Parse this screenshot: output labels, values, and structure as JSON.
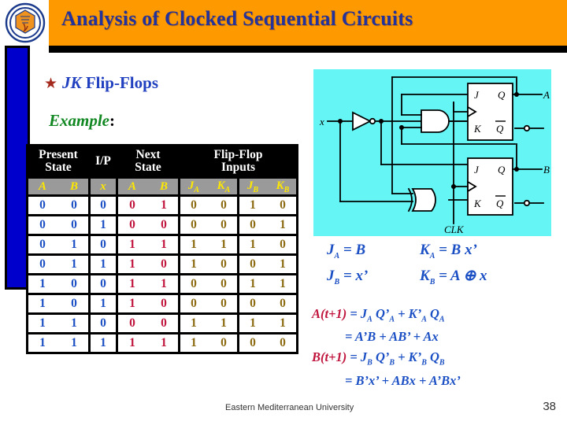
{
  "slide": {
    "title": "Analysis of Clocked Sequential Circuits",
    "logo_icon": "university-seal-icon",
    "bullet": {
      "star_icon": "star-bullet-icon",
      "italic_part": "JK",
      "upright_part": "Flip-Flops"
    },
    "example_label": "Example",
    "example_colon": ":",
    "colors": {
      "title_bar": "#FF9900",
      "title_text": "#23339B",
      "side_bar": "#0000CC",
      "circuit_bg": "#66F5F5",
      "present_state": "#1B4FC4",
      "next_state": "#C0143C",
      "ff_inputs": "#8C6A10",
      "subheader_bg": "#9A9A9A",
      "subheader_text": "#FFE800",
      "example_text": "#118822",
      "star": "#A52A1E"
    }
  },
  "table": {
    "group_headers": [
      {
        "label": "Present\nState",
        "colspan": 2
      },
      {
        "label": "I/P",
        "colspan": 1
      },
      {
        "label": "Next\nState",
        "colspan": 2
      },
      {
        "label": "Flip-Flop\nInputs",
        "colspan": 4
      }
    ],
    "group_headers_flat": [
      "Present State",
      "I/P",
      "Next State",
      "Flip-Flop Inputs"
    ],
    "sub_headers": [
      {
        "text": "A",
        "sub": ""
      },
      {
        "text": "B",
        "sub": ""
      },
      {
        "text": "x",
        "sub": ""
      },
      {
        "text": "A",
        "sub": ""
      },
      {
        "text": "B",
        "sub": ""
      },
      {
        "text": "J",
        "sub": "A"
      },
      {
        "text": "K",
        "sub": "A"
      },
      {
        "text": "J",
        "sub": "B"
      },
      {
        "text": "K",
        "sub": "B"
      }
    ],
    "rows": [
      {
        "present": [
          "0",
          "0"
        ],
        "input": [
          "0"
        ],
        "next": [
          "0",
          "1"
        ],
        "ff": [
          "0",
          "0",
          "1",
          "0"
        ]
      },
      {
        "present": [
          "0",
          "0"
        ],
        "input": [
          "1"
        ],
        "next": [
          "0",
          "0"
        ],
        "ff": [
          "0",
          "0",
          "0",
          "1"
        ]
      },
      {
        "present": [
          "0",
          "1"
        ],
        "input": [
          "0"
        ],
        "next": [
          "1",
          "1"
        ],
        "ff": [
          "1",
          "1",
          "1",
          "0"
        ]
      },
      {
        "present": [
          "0",
          "1"
        ],
        "input": [
          "1"
        ],
        "next": [
          "1",
          "0"
        ],
        "ff": [
          "1",
          "0",
          "0",
          "1"
        ]
      },
      {
        "present": [
          "1",
          "0"
        ],
        "input": [
          "0"
        ],
        "next": [
          "1",
          "1"
        ],
        "ff": [
          "0",
          "0",
          "1",
          "1"
        ]
      },
      {
        "present": [
          "1",
          "0"
        ],
        "input": [
          "1"
        ],
        "next": [
          "1",
          "0"
        ],
        "ff": [
          "0",
          "0",
          "0",
          "0"
        ]
      },
      {
        "present": [
          "1",
          "1"
        ],
        "input": [
          "0"
        ],
        "next": [
          "0",
          "0"
        ],
        "ff": [
          "1",
          "1",
          "1",
          "1"
        ]
      },
      {
        "present": [
          "1",
          "1"
        ],
        "input": [
          "1"
        ],
        "next": [
          "1",
          "1"
        ],
        "ff": [
          "1",
          "0",
          "0",
          "0"
        ]
      }
    ]
  },
  "circuit": {
    "labels": {
      "input_x": "x",
      "clock": "CLK",
      "output_a": "A",
      "output_b": "B",
      "ff1_j": "J",
      "ff1_k": "K",
      "ff1_q": "Q",
      "ff1_qbar": "Q",
      "ff2_j": "J",
      "ff2_k": "K",
      "ff2_q": "Q",
      "ff2_qbar": "Q"
    },
    "gates": [
      "not-gate",
      "and-gate",
      "xor-gate",
      "jk-flipflop-a",
      "jk-flipflop-b"
    ]
  },
  "equations": {
    "ja": "J",
    "ja_sub": "A",
    "ja_rhs": "= B",
    "ka": "K",
    "ka_sub": "A",
    "ka_rhs": "= B x’",
    "jb": "J",
    "jb_sub": "B",
    "jb_rhs": "= x’",
    "kb": "K",
    "kb_sub": "B",
    "kb_rhs": "= A ⊕ x",
    "a_next_lhs": "A(t+1)",
    "a_next_rhs1": "= J",
    "a_next_rhs1_full": "= J A Q’A + K’A QA",
    "a_next_rhs2": "= A’B + AB’ + Ax",
    "b_next_lhs": "B(t+1)",
    "b_next_rhs1_full": "= J B Q’B + K’B QB",
    "b_next_rhs2": "= B’x’ + ABx + A’Bx’"
  },
  "footer": {
    "institution": "Eastern Mediterranean University",
    "page_number": "38"
  }
}
